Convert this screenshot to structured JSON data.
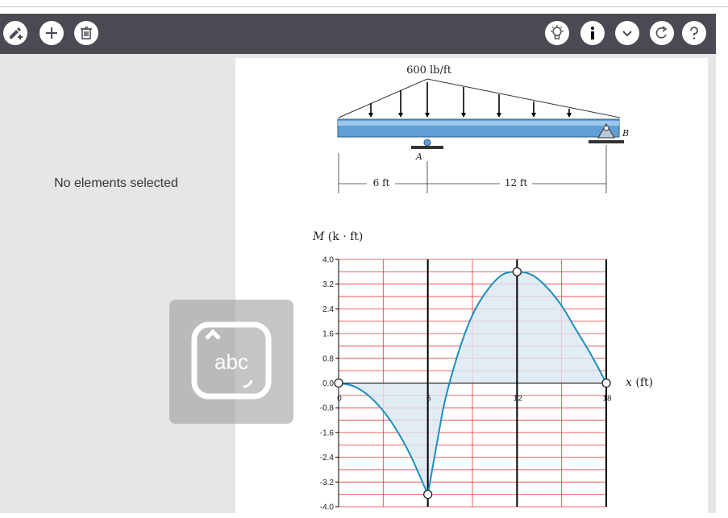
{
  "toolbar": {
    "left_buttons": [
      "draw-pen-icon",
      "plus-icon",
      "trash-icon"
    ],
    "right_buttons": [
      "lightbulb-icon",
      "info-icon",
      "chevron-down-icon",
      "redo-icon",
      "question-icon"
    ]
  },
  "left_panel": {
    "status": "No elements selected"
  },
  "keyboard_overlay": {
    "label": "abc"
  },
  "beam_figure": {
    "load_label": "600 lb/ft",
    "support_a": "A",
    "support_b": "B",
    "span1_label": "6 ft",
    "span2_label": "12 ft"
  },
  "chart_data": {
    "type": "line",
    "ylabel_var": "M",
    "ylabel_unit": "(k · ft)",
    "xlabel_var": "x",
    "xlabel_unit": "(ft)",
    "xlim": [
      0,
      18
    ],
    "ylim": [
      -4.0,
      4.0
    ],
    "y_ticks": [
      "4.0",
      "3.2",
      "2.4",
      "1.6",
      "0.8",
      "0.0",
      "-0.8",
      "-1.6",
      "-2.4",
      "-3.2",
      "-4.0"
    ],
    "x_ticks": [
      "0",
      "6",
      "12",
      "18"
    ],
    "grid": true,
    "control_points": [
      {
        "x": 0,
        "y": 0.0
      },
      {
        "x": 6,
        "y": -3.6
      },
      {
        "x": 12,
        "y": 3.6
      },
      {
        "x": 18,
        "y": 0.0
      }
    ],
    "series": [
      {
        "values_x": [
          0,
          1,
          2,
          3,
          4,
          5,
          6,
          7,
          8,
          9,
          10,
          11,
          12,
          13,
          14,
          15,
          16,
          17,
          18
        ],
        "values_y": [
          0.0,
          -0.1,
          -0.4,
          -0.9,
          -1.6,
          -2.5,
          -3.6,
          -0.9,
          0.9,
          2.2,
          3.0,
          3.5,
          3.6,
          3.5,
          3.1,
          2.5,
          1.7,
          0.9,
          0.0
        ]
      }
    ],
    "colors": {
      "curve": "#1a8fbf",
      "fill": "#dbe7f2",
      "grid": "#e8383a",
      "axis": "#000000"
    }
  }
}
